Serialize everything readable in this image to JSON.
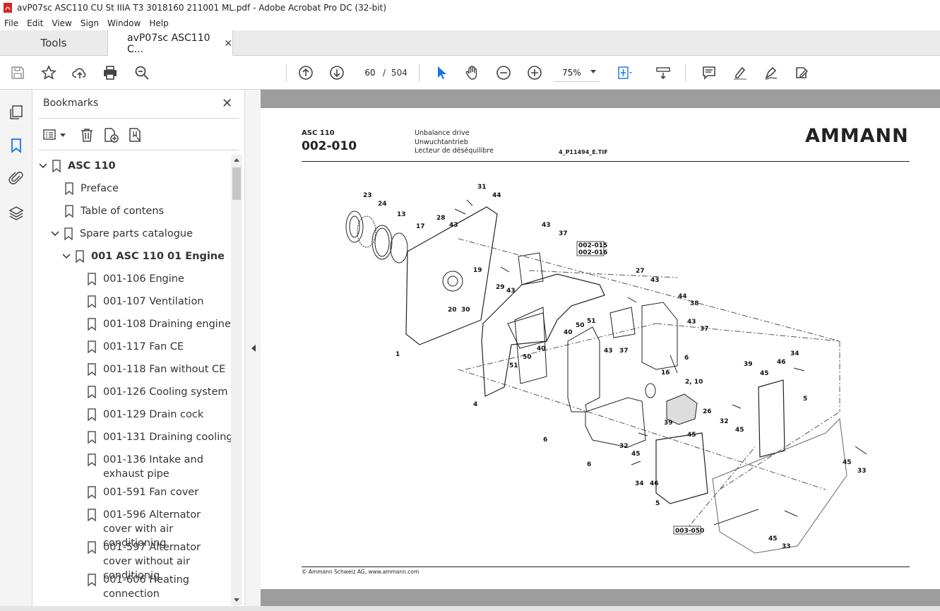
{
  "window": {
    "title": "avP07sc ASC110 CU St IIIA T3 3018160 211001 ML.pdf - Adobe Acrobat Pro DC (32-bit)"
  },
  "menu": [
    "File",
    "Edit",
    "View",
    "Sign",
    "Window",
    "Help"
  ],
  "tabs": {
    "tools": "Tools",
    "document": "avP07sc ASC110 C..."
  },
  "toolbar": {
    "current_page": "60",
    "separator": "/",
    "total_pages": "504",
    "zoom": "75%"
  },
  "bookmarks": {
    "title": "Bookmarks",
    "items": [
      {
        "label": "ASC 110"
      },
      {
        "label": "Preface"
      },
      {
        "label": "Table of contens"
      },
      {
        "label": "Spare parts catalogue"
      },
      {
        "label": "001 ASC 110 01 Engine"
      },
      {
        "label": "001-106 Engine"
      },
      {
        "label": "001-107 Ventilation"
      },
      {
        "label": "001-108 Draining engine"
      },
      {
        "label": "001-117 Fan CE"
      },
      {
        "label": "001-118 Fan without CE"
      },
      {
        "label": "001-126 Cooling system"
      },
      {
        "label": "001-129 Drain cock"
      },
      {
        "label": "001-131 Draining cooling"
      },
      {
        "label": "001-136 Intake and exhaust pipe"
      },
      {
        "label": "001-591 Fan cover"
      },
      {
        "label": "001-596 Alternator cover with air conditioning"
      },
      {
        "label": "001-597 Alternator cover without air conditionig"
      },
      {
        "label": "001-606 Heating connection"
      }
    ]
  },
  "document_page": {
    "model": "ASC 110",
    "code": "002-010",
    "desc_en": "Unbalance drive",
    "desc_de": "Unwuchtantrieb",
    "desc_fr": "Lecteur de déséquilibre",
    "file": "4_P11494_E.TIF",
    "logo": "AMMANN",
    "footer": "© Ammann Schweiz AG, www.ammann.com",
    "refs": [
      "002-015",
      "002-016",
      "003-050"
    ],
    "callouts": [
      "23",
      "24",
      "13",
      "17",
      "31",
      "44",
      "28",
      "43",
      "19",
      "29",
      "43",
      "20",
      "30",
      "1",
      "43",
      "37",
      "27",
      "43",
      "44",
      "38",
      "43",
      "37",
      "51",
      "40",
      "40",
      "50",
      "43",
      "37",
      "6",
      "51",
      "50",
      "4",
      "16",
      "2, 10",
      "26",
      "34",
      "46",
      "39",
      "45",
      "5",
      "32",
      "45",
      "6",
      "32",
      "39",
      "45",
      "45",
      "6",
      "34",
      "46",
      "5",
      "45",
      "33",
      "45",
      "33"
    ]
  }
}
